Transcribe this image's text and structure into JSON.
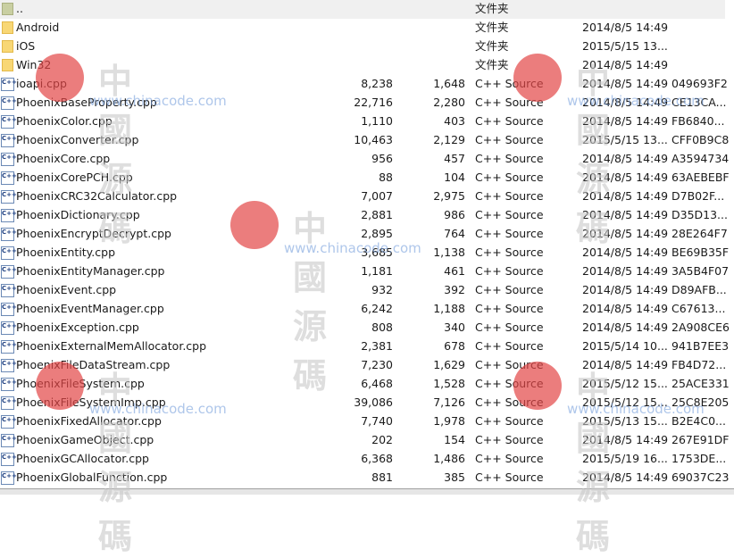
{
  "files": [
    {
      "name": "..",
      "size": "",
      "packed": "",
      "type": "文件夹",
      "modified": "",
      "crc": "",
      "icon": "folder-up-icon",
      "selected": true
    },
    {
      "name": "Android",
      "size": "",
      "packed": "",
      "type": "文件夹",
      "modified": "2014/8/5 14:49",
      "crc": "",
      "icon": "folder-icon"
    },
    {
      "name": "iOS",
      "size": "",
      "packed": "",
      "type": "文件夹",
      "modified": "2015/5/15 13...",
      "crc": "",
      "icon": "folder-icon"
    },
    {
      "name": "Win32",
      "size": "",
      "packed": "",
      "type": "文件夹",
      "modified": "2014/8/5 14:49",
      "crc": "",
      "icon": "folder-icon"
    },
    {
      "name": "ioapi.cpp",
      "size": "8,238",
      "packed": "1,648",
      "type": "C++ Source",
      "modified": "2014/8/5 14:49",
      "crc": "049693F2",
      "icon": "cpp-file-icon"
    },
    {
      "name": "PhoenixBaseProperty.cpp",
      "size": "22,716",
      "packed": "2,280",
      "type": "C++ Source",
      "modified": "2014/8/5 14:49",
      "crc": "CE13CA...",
      "icon": "cpp-file-icon"
    },
    {
      "name": "PhoenixColor.cpp",
      "size": "1,110",
      "packed": "403",
      "type": "C++ Source",
      "modified": "2014/8/5 14:49",
      "crc": "FB6840...",
      "icon": "cpp-file-icon"
    },
    {
      "name": "PhoenixConverter.cpp",
      "size": "10,463",
      "packed": "2,129",
      "type": "C++ Source",
      "modified": "2015/5/15 13...",
      "crc": "CFF0B9C8",
      "icon": "cpp-file-icon"
    },
    {
      "name": "PhoenixCore.cpp",
      "size": "956",
      "packed": "457",
      "type": "C++ Source",
      "modified": "2014/8/5 14:49",
      "crc": "A3594734",
      "icon": "cpp-file-icon"
    },
    {
      "name": "PhoenixCorePCH.cpp",
      "size": "88",
      "packed": "104",
      "type": "C++ Source",
      "modified": "2014/8/5 14:49",
      "crc": "63AEBEBF",
      "icon": "cpp-file-icon"
    },
    {
      "name": "PhoenixCRC32Calculator.cpp",
      "size": "7,007",
      "packed": "2,975",
      "type": "C++ Source",
      "modified": "2014/8/5 14:49",
      "crc": "D7B02F...",
      "icon": "cpp-file-icon"
    },
    {
      "name": "PhoenixDictionary.cpp",
      "size": "2,881",
      "packed": "986",
      "type": "C++ Source",
      "modified": "2014/8/5 14:49",
      "crc": "D35D13...",
      "icon": "cpp-file-icon"
    },
    {
      "name": "PhoenixEncryptDecrypt.cpp",
      "size": "2,895",
      "packed": "764",
      "type": "C++ Source",
      "modified": "2014/8/5 14:49",
      "crc": "28E264F7",
      "icon": "cpp-file-icon"
    },
    {
      "name": "PhoenixEntity.cpp",
      "size": "3,685",
      "packed": "1,138",
      "type": "C++ Source",
      "modified": "2014/8/5 14:49",
      "crc": "BE69B35F",
      "icon": "cpp-file-icon"
    },
    {
      "name": "PhoenixEntityManager.cpp",
      "size": "1,181",
      "packed": "461",
      "type": "C++ Source",
      "modified": "2014/8/5 14:49",
      "crc": "3A5B4F07",
      "icon": "cpp-file-icon"
    },
    {
      "name": "PhoenixEvent.cpp",
      "size": "932",
      "packed": "392",
      "type": "C++ Source",
      "modified": "2014/8/5 14:49",
      "crc": "D89AFB...",
      "icon": "cpp-file-icon"
    },
    {
      "name": "PhoenixEventManager.cpp",
      "size": "6,242",
      "packed": "1,188",
      "type": "C++ Source",
      "modified": "2014/8/5 14:49",
      "crc": "C67613...",
      "icon": "cpp-file-icon"
    },
    {
      "name": "PhoenixException.cpp",
      "size": "808",
      "packed": "340",
      "type": "C++ Source",
      "modified": "2014/8/5 14:49",
      "crc": "2A908CE6",
      "icon": "cpp-file-icon"
    },
    {
      "name": "PhoenixExternalMemAllocator.cpp",
      "size": "2,381",
      "packed": "678",
      "type": "C++ Source",
      "modified": "2015/5/14 10...",
      "crc": "941B7EE3",
      "icon": "cpp-file-icon"
    },
    {
      "name": "PhoenixFileDataStream.cpp",
      "size": "7,230",
      "packed": "1,629",
      "type": "C++ Source",
      "modified": "2014/8/5 14:49",
      "crc": "FB4D72...",
      "icon": "cpp-file-icon"
    },
    {
      "name": "PhoenixFileSystem.cpp",
      "size": "6,468",
      "packed": "1,528",
      "type": "C++ Source",
      "modified": "2015/5/12 15...",
      "crc": "25ACE331",
      "icon": "cpp-file-icon"
    },
    {
      "name": "PhoenixFileSystemImp.cpp",
      "size": "39,086",
      "packed": "7,126",
      "type": "C++ Source",
      "modified": "2015/5/12 15...",
      "crc": "25C8E205",
      "icon": "cpp-file-icon"
    },
    {
      "name": "PhoenixFixedAllocator.cpp",
      "size": "7,740",
      "packed": "1,978",
      "type": "C++ Source",
      "modified": "2015/5/13 15...",
      "crc": "B2E4C0...",
      "icon": "cpp-file-icon"
    },
    {
      "name": "PhoenixGameObject.cpp",
      "size": "202",
      "packed": "154",
      "type": "C++ Source",
      "modified": "2014/8/5 14:49",
      "crc": "267E91DF",
      "icon": "cpp-file-icon"
    },
    {
      "name": "PhoenixGCAllocator.cpp",
      "size": "6,368",
      "packed": "1,486",
      "type": "C++ Source",
      "modified": "2015/5/19 16...",
      "crc": "1753DE...",
      "icon": "cpp-file-icon"
    },
    {
      "name": "PhoenixGlobalFunction.cpp",
      "size": "881",
      "packed": "385",
      "type": "C++ Source",
      "modified": "2014/8/5 14:49",
      "crc": "69037C23",
      "icon": "cpp-file-icon"
    }
  ],
  "watermark": {
    "text": "中國源碼",
    "url": "www.chinacode.com"
  }
}
